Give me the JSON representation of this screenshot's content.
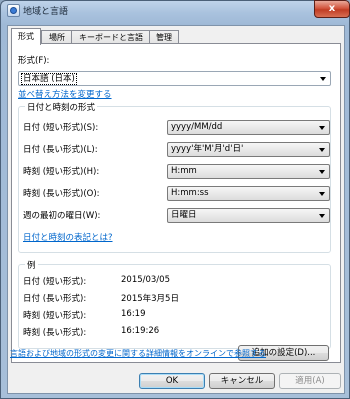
{
  "window": {
    "title": "地域と言語",
    "close_symbol": "x"
  },
  "tabs": [
    {
      "label": "形式",
      "active": true
    },
    {
      "label": "場所",
      "active": false
    },
    {
      "label": "キーボードと言語",
      "active": false
    },
    {
      "label": "管理",
      "active": false
    }
  ],
  "format": {
    "label": "形式(F):",
    "value": "日本語 (日本)",
    "sort_link": "並べ替え方法を変更する"
  },
  "datetime_group": {
    "title": "日付と時刻の形式",
    "rows": [
      {
        "label": "日付 (短い形式)(S):",
        "value": "yyyy/MM/dd"
      },
      {
        "label": "日付 (長い形式)(L):",
        "value": "yyyy'年'M'月'd'日'"
      },
      {
        "label": "時刻 (短い形式)(H):",
        "value": "H:mm"
      },
      {
        "label": "時刻 (長い形式)(O):",
        "value": "H:mm:ss"
      },
      {
        "label": "週の最初の曜日(W):",
        "value": "日曜日"
      }
    ],
    "notation_link": "日付と時刻の表記とは?"
  },
  "example_group": {
    "title": "例",
    "rows": [
      {
        "label": "日付 (短い形式):",
        "value": "2015/03/05"
      },
      {
        "label": "日付 (長い形式):",
        "value": "2015年3月5日"
      },
      {
        "label": "時刻 (短い形式):",
        "value": "16:19"
      },
      {
        "label": "時刻 (長い形式):",
        "value": "16:19:26"
      }
    ]
  },
  "additional_settings_button": "追加の設定(D)...",
  "online_link": "言語および地域の形式の変更に関する詳細情報をオンラインで参照する",
  "buttons": {
    "ok": "OK",
    "cancel": "キャンセル",
    "apply": "適用(A)"
  }
}
